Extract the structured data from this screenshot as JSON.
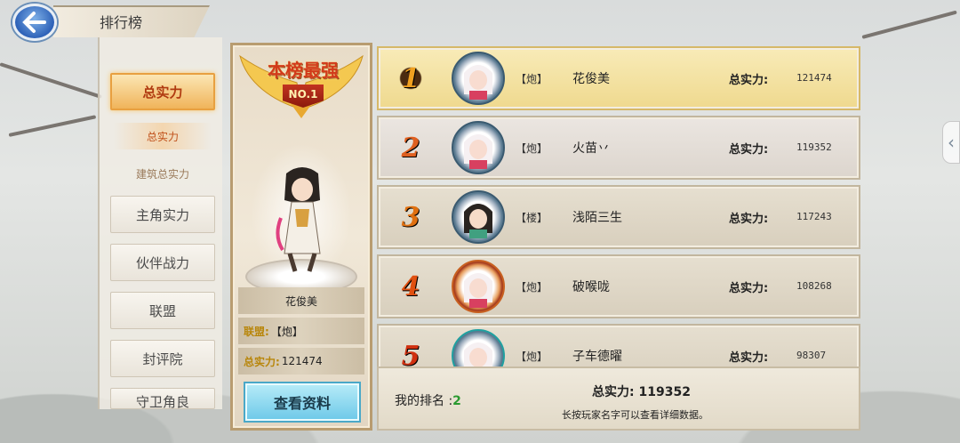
{
  "header": {
    "title": "排行榜"
  },
  "sidebar": {
    "tabs": [
      {
        "label": "总实力",
        "active": true
      },
      {
        "label": "主角实力",
        "active": false
      },
      {
        "label": "伙伴战力",
        "active": false
      },
      {
        "label": "联盟",
        "active": false
      },
      {
        "label": "封评院",
        "active": false
      },
      {
        "label": "守卫角良",
        "active": false
      }
    ],
    "subtabs": [
      {
        "label": "总实力",
        "active": true
      },
      {
        "label": "建筑总实力",
        "active": false
      }
    ]
  },
  "champion": {
    "banner_title": "本榜最强",
    "badge": "NO.1",
    "name": "花俊美",
    "guild_label": "联盟:",
    "guild_value": "【炮】",
    "power_label": "总实力:",
    "power_value": "121474",
    "view_button": "查看资料"
  },
  "rankings": [
    {
      "rank": "1",
      "guild": "【炮】",
      "name": "花俊美",
      "power_label": "总实力:",
      "power": "121474"
    },
    {
      "rank": "2",
      "guild": "【炮】",
      "name": "火苗丷",
      "power_label": "总实力:",
      "power": "119352"
    },
    {
      "rank": "3",
      "guild": "【楼】",
      "name": "浅陌三生",
      "power_label": "总实力:",
      "power": "117243"
    },
    {
      "rank": "4",
      "guild": "【炮】",
      "name": "破喉咙",
      "power_label": "总实力:",
      "power": "108268"
    },
    {
      "rank": "5",
      "guild": "【炮】",
      "name": "子车德曜",
      "power_label": "总实力:",
      "power": "98307"
    }
  ],
  "my_rank": {
    "label": "我的排名 :",
    "value": "2",
    "power_label": "总实力:",
    "power_value": "119352",
    "hint": "长按玩家名字可以查看详细数据。"
  },
  "colors": {
    "accent": "#f0b45a",
    "active_text": "#b03a10",
    "rank_green": "#2a9a30"
  }
}
